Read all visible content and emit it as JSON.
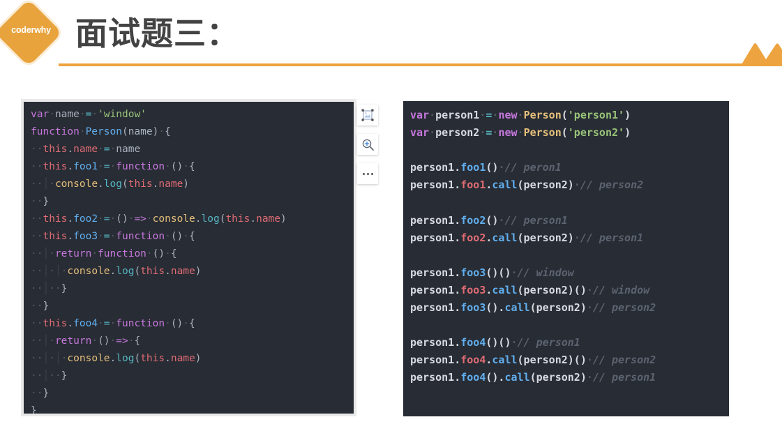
{
  "header": {
    "logo_text": "coderwhy",
    "logo_icon": "diamond-logo",
    "title": "面试题三：",
    "accent_color": "#eda33f",
    "title_color": "#434343",
    "peaks_icon": "mountain-peaks-decoration"
  },
  "toolbar": {
    "buttons": [
      {
        "name": "image-crop-icon",
        "label": ""
      },
      {
        "name": "zoom-in-icon",
        "label": ""
      },
      {
        "name": "more-options-icon",
        "label": ""
      }
    ]
  },
  "code_left": {
    "background": "#282c34",
    "language": "javascript",
    "lines": [
      "var name = 'window'",
      "function Person(name) {",
      "  this.name = name",
      "  this.foo1 = function () {",
      "    console.log(this.name)",
      "  }",
      "  this.foo2 = () => console.log(this.name)",
      "  this.foo3 = function () {",
      "    return function () {",
      "      console.log(this.name)",
      "    }",
      "  }",
      "  this.foo4 = function () {",
      "    return () => {",
      "      console.log(this.name)",
      "    }",
      "  }",
      "}"
    ]
  },
  "code_right": {
    "background": "#282c34",
    "language": "javascript",
    "lines": [
      "var person1 = new Person('person1')",
      "var person2 = new Person('person2')",
      "",
      "person1.foo1() // peron1",
      "person1.foo1.call(person2) // person2",
      "",
      "person1.foo2() // person1",
      "person1.foo2.call(person2) // person1",
      "",
      "person1.foo3()() // window",
      "person1.foo3.call(person2)() // window",
      "person1.foo3().call(person2) // person2",
      "",
      "person1.foo4()() // person1",
      "person1.foo4.call(person2)() // person2",
      "person1.foo4().call(person2) // person1"
    ]
  }
}
